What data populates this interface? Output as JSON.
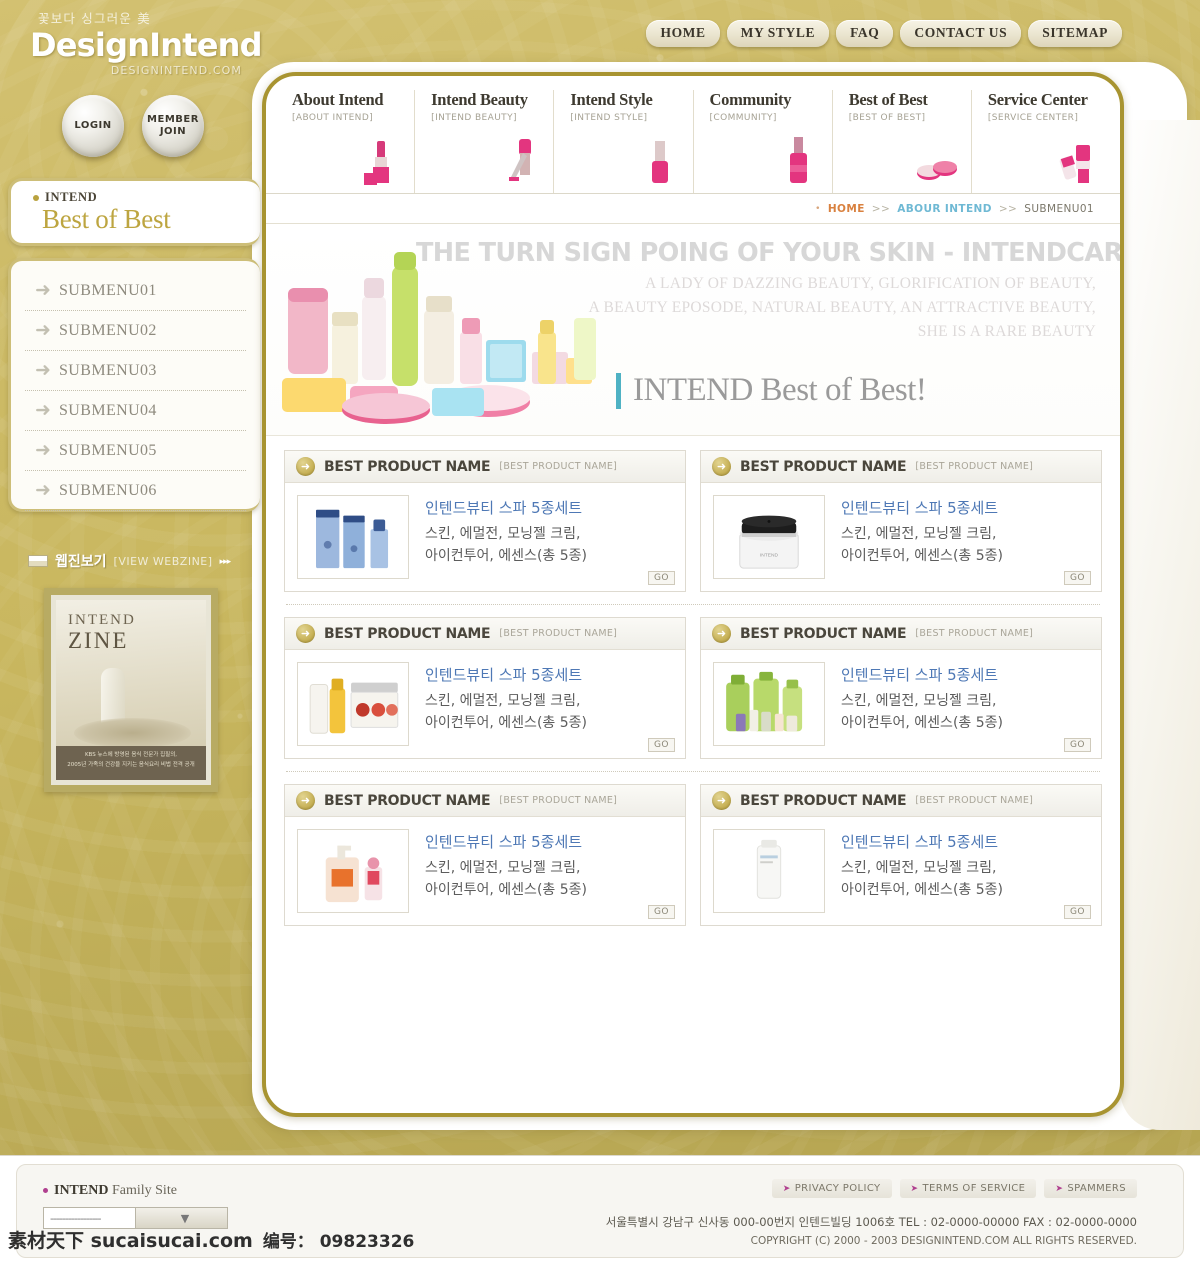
{
  "site": {
    "logo_tagline_kr": "꽃보다 싱그러운 美",
    "logo_main": "DesignIntend",
    "logo_domain": "DESIGNINTEND.COM"
  },
  "top_nav": [
    {
      "label": "HOME"
    },
    {
      "label": "MY STYLE"
    },
    {
      "label": "FAQ"
    },
    {
      "label": "CONTACT US"
    },
    {
      "label": "SITEMAP"
    }
  ],
  "orbs": [
    {
      "label": "LOGIN",
      "line2": ""
    },
    {
      "label": "MEMBER",
      "line2": "JOIN"
    }
  ],
  "sidebar": {
    "eyebrow": "INTEND",
    "title": "Best of Best",
    "items": [
      {
        "label": "SUBMENU01"
      },
      {
        "label": "SUBMENU02"
      },
      {
        "label": "SUBMENU03"
      },
      {
        "label": "SUBMENU04"
      },
      {
        "label": "SUBMENU05"
      },
      {
        "label": "SUBMENU06"
      }
    ],
    "webzine": {
      "title_kr": "웹진보기",
      "title_en": "[VIEW WEBZINE]",
      "arrows": "▸▸▸",
      "cover_line1": "INTEND",
      "cover_line2": "ZINE",
      "cover_caption1": "KBS 뉴스에 방영된 음식 전문가 집필의,",
      "cover_caption2": "2005년 가족의 건강을 지키는 음식요리 비법 전격 공개"
    }
  },
  "main_nav": [
    {
      "title": "About Intend",
      "sub": "[ABOUT INTEND]",
      "icon": "lipstick-icon"
    },
    {
      "title": "Intend Beauty",
      "sub": "[INTEND BEAUTY]",
      "icon": "mascara-icon"
    },
    {
      "title": "Intend Style",
      "sub": "[INTEND STYLE]",
      "icon": "nailpolish-icon"
    },
    {
      "title": "Community",
      "sub": "[COMMUNITY]",
      "icon": "nailbottle-icon"
    },
    {
      "title": "Best of Best",
      "sub": "[BEST OF BEST]",
      "icon": "compact-icon"
    },
    {
      "title": "Service Center",
      "sub": "[SERVICE CENTER]",
      "icon": "tubes-icon"
    }
  ],
  "breadcrumb": {
    "dot": "•",
    "home": "HOME",
    "sep": ">>",
    "mid": "ABOUR INTEND",
    "current": "SUBMENU01"
  },
  "banner": {
    "ghost_headline": "THE TURN SIGN POING OF YOUR SKIN - INTENDCARE",
    "ghost_line1": "A LADY OF DAZZING BEAUTY, GLORIFICATION OF BEAUTY,",
    "ghost_line2": "A BEAUTY EPOSODE, NATURAL BEAUTY, AN ATTRACTIVE BEAUTY,",
    "ghost_line3": "SHE IS A RARE BEAUTY",
    "title": "INTEND Best of Best!",
    "accent_color": "#4fb2c4"
  },
  "products": [
    {
      "head_title": "BEST PRODUCT NAME",
      "head_sub": "[BEST PRODUCT NAME]",
      "name": "인텐드뷰티 스파 5종세트",
      "desc_line1": "스킨, 에멀전, 모닝젤 크림,",
      "desc_line2": "아이컨투어, 에센스(총 5종)",
      "go": "GO",
      "thumb": "blue-skincare-set"
    },
    {
      "head_title": "BEST PRODUCT NAME",
      "head_sub": "[BEST PRODUCT NAME]",
      "name": "인텐드뷰티 스파 5종세트",
      "desc_line1": "스킨, 에멀전, 모닝젤 크림,",
      "desc_line2": "아이컨투어, 에센스(총 5종)",
      "go": "GO",
      "thumb": "white-cream-jar"
    },
    {
      "head_title": "BEST PRODUCT NAME",
      "head_sub": "[BEST PRODUCT NAME]",
      "name": "인텐드뷰티 스파 5종세트",
      "desc_line1": "스킨, 에멀전, 모닝젤 크림,",
      "desc_line2": "아이컨투어, 에센스(총 5종)",
      "go": "GO",
      "thumb": "makeup-palette-serum"
    },
    {
      "head_title": "BEST PRODUCT NAME",
      "head_sub": "[BEST PRODUCT NAME]",
      "name": "인텐드뷰티 스파 5종세트",
      "desc_line1": "스킨, 에멀전, 모닝젤 크림,",
      "desc_line2": "아이컨투어, 에센스(총 5종)",
      "go": "GO",
      "thumb": "green-herbal-set"
    },
    {
      "head_title": "BEST PRODUCT NAME",
      "head_sub": "[BEST PRODUCT NAME]",
      "name": "인텐드뷰티 스파 5종세트",
      "desc_line1": "스킨, 에멀전, 모닝젤 크림,",
      "desc_line2": "아이컨투어, 에센스(총 5종)",
      "go": "GO",
      "thumb": "orange-pump-rollon"
    },
    {
      "head_title": "BEST PRODUCT NAME",
      "head_sub": "[BEST PRODUCT NAME]",
      "name": "인텐드뷰티 스파 5종세트",
      "desc_line1": "스킨, 에멀전, 모닝젤 크림,",
      "desc_line2": "아이컨투어, 에센스(총 5종)",
      "go": "GO",
      "thumb": "white-tube"
    }
  ],
  "footer": {
    "family_dot": "•",
    "family_strong": "INTEND",
    "family_rest": " Family Site",
    "select_value": "-----------------",
    "links": [
      {
        "bullet": "➤",
        "label": "PRIVACY POLICY"
      },
      {
        "bullet": "➤",
        "label": "TERMS OF SERVICE"
      },
      {
        "bullet": "➤",
        "label": "SPAMMERS"
      }
    ],
    "address": "서울특별시  강남구 신사동 000-00번지 인텐드빌딩 1006호  TEL : 02-0000-00000  FAX : 02-0000-0000",
    "copyright": "COPYRIGHT (C) 2000 - 2003 DESIGNINTEND.COM  ALL RIGHTS RESERVED."
  },
  "watermark": {
    "text": "素材天下 sucaisucai.com",
    "code": "编号： 09823326"
  }
}
